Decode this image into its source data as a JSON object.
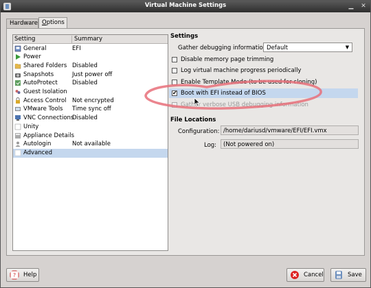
{
  "window": {
    "title": "Virtual Machine Settings"
  },
  "tabs": [
    {
      "label_pre": "Hardware",
      "label_ul": "",
      "label_post": ""
    },
    {
      "label_pre": "",
      "label_ul": "O",
      "label_post": "ptions"
    }
  ],
  "list": {
    "col_setting": "Setting",
    "col_summary": "Summary",
    "rows": [
      {
        "label": "General",
        "value": "EFI",
        "icon": "general-icon"
      },
      {
        "label": "Power",
        "value": "",
        "icon": "power-icon"
      },
      {
        "label": "Shared Folders",
        "value": "Disabled",
        "icon": "shared-folders-icon"
      },
      {
        "label": "Snapshots",
        "value": "Just power off",
        "icon": "snapshots-icon"
      },
      {
        "label": "AutoProtect",
        "value": "Disabled",
        "icon": "autoprotect-icon"
      },
      {
        "label": "Guest Isolation",
        "value": "",
        "icon": "guest-isolation-icon"
      },
      {
        "label": "Access Control",
        "value": "Not encrypted",
        "icon": "access-control-icon"
      },
      {
        "label": "VMware Tools",
        "value": "Time sync off",
        "icon": "vmware-tools-icon"
      },
      {
        "label": "VNC Connections",
        "value": "Disabled",
        "icon": "vnc-icon"
      },
      {
        "label": "Unity",
        "value": "",
        "icon": "unity-icon"
      },
      {
        "label": "Appliance Details",
        "value": "",
        "icon": "appliance-icon"
      },
      {
        "label": "Autologin",
        "value": "Not available",
        "icon": "autologin-icon"
      },
      {
        "label": "Advanced",
        "value": "",
        "icon": "advanced-icon"
      }
    ]
  },
  "settings": {
    "heading": "Settings",
    "debug_label": "Gather debugging information:",
    "debug_value": "Default",
    "checks": [
      {
        "label": "Disable memory page trimming",
        "checked": false,
        "disabled": false
      },
      {
        "label": "Log virtual machine progress periodically",
        "checked": false,
        "disabled": false
      },
      {
        "label": "Enable Template Mode (to be used for cloning)",
        "checked": false,
        "disabled": false
      },
      {
        "label": "Boot with EFI instead of BIOS",
        "checked": true,
        "disabled": false
      },
      {
        "label": "Gather verbose USB debugging information",
        "checked": false,
        "disabled": true
      }
    ]
  },
  "file_locations": {
    "heading": "File Locations",
    "config_label": "Configuration:",
    "config_value": "/home/dariusd/vmware/EFI/EFI.vmx",
    "log_label": "Log:",
    "log_value": "(Not powered on)"
  },
  "buttons": {
    "help": "Help",
    "cancel": "Cancel",
    "save": "Save"
  },
  "colors": {
    "selection": "#c4d7ee",
    "annotation": "#e8707a"
  }
}
